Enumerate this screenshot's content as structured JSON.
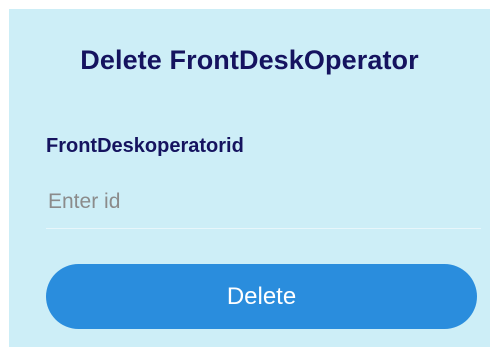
{
  "form": {
    "title": "Delete FrontDeskOperator",
    "field_label": "FrontDeskoperatorid",
    "id_input": {
      "value": "",
      "placeholder": "Enter id"
    },
    "delete_button_label": "Delete"
  },
  "colors": {
    "background": "#cdeef7",
    "title_text": "#15135f",
    "button_background": "#2a8ddd",
    "button_text": "#ffffff",
    "placeholder_text": "#8b8b8b"
  }
}
